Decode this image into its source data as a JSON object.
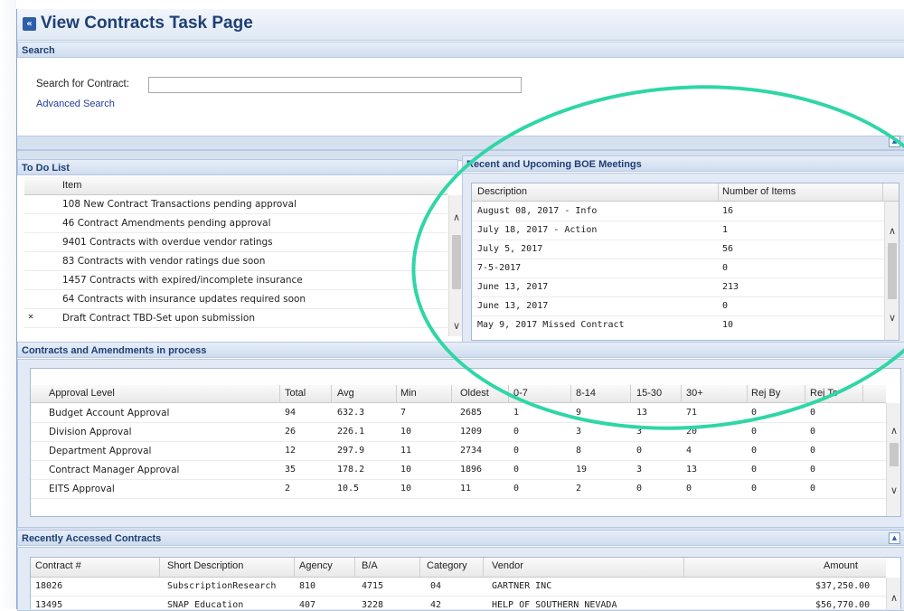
{
  "page": {
    "title": "View Contracts Task Page",
    "collapse_icon": "double-chevron-left-icon"
  },
  "search": {
    "header": "Search",
    "label": "Search for Contract:",
    "value": "",
    "placeholder": "",
    "advanced_link": "Advanced Search"
  },
  "todo": {
    "header": "To Do List",
    "column": "Item",
    "items": [
      {
        "icon": "",
        "text": "108 New Contract Transactions pending approval"
      },
      {
        "icon": "",
        "text": "46 Contract Amendments pending approval"
      },
      {
        "icon": "",
        "text": "9401 Contracts with overdue vendor ratings"
      },
      {
        "icon": "",
        "text": "83 Contracts with vendor ratings due soon"
      },
      {
        "icon": "",
        "text": "1457 Contracts with expired/incomplete insurance"
      },
      {
        "icon": "",
        "text": "64 Contracts with insurance updates required soon"
      },
      {
        "icon": "✕",
        "text": "Draft Contract TBD-Set upon submission"
      }
    ]
  },
  "boe": {
    "header": "Recent and Upcoming BOE Meetings",
    "columns": [
      "Description",
      "Number of Items"
    ],
    "rows": [
      [
        "August 08, 2017 - Info",
        "16"
      ],
      [
        "July 18, 2017 - Action",
        "1"
      ],
      [
        "July 5, 2017",
        "56"
      ],
      [
        "7-5-2017",
        "0"
      ],
      [
        "June 13, 2017",
        "213"
      ],
      [
        "June 13, 2017",
        "0"
      ],
      [
        "May 9, 2017 Missed Contract",
        "10"
      ]
    ]
  },
  "process": {
    "header": "Contracts and Amendments in process",
    "columns": [
      "Approval Level",
      "Total",
      "Avg",
      "Min",
      "Oldest",
      "0-7",
      "8-14",
      "15-30",
      "30+",
      "Rej By",
      "Rej To"
    ],
    "rows": [
      [
        "Budget Account Approval",
        "94",
        "632.3",
        "7",
        "2685",
        "1",
        "9",
        "13",
        "71",
        "0",
        "0"
      ],
      [
        "Division Approval",
        "26",
        "226.1",
        "10",
        "1209",
        "0",
        "3",
        "3",
        "20",
        "0",
        "0"
      ],
      [
        "Department Approval",
        "12",
        "297.9",
        "11",
        "2734",
        "0",
        "8",
        "0",
        "4",
        "0",
        "0"
      ],
      [
        "Contract Manager Approval",
        "35",
        "178.2",
        "10",
        "1896",
        "0",
        "19",
        "3",
        "13",
        "0",
        "0"
      ],
      [
        "EITS Approval",
        "2",
        "10.5",
        "10",
        "11",
        "0",
        "2",
        "0",
        "0",
        "0",
        "0"
      ]
    ]
  },
  "recent": {
    "header": "Recently Accessed Contracts",
    "columns": [
      "Contract #",
      "Short Description",
      "Agency",
      "B/A",
      "Category",
      "Vendor",
      "Amount"
    ],
    "rows": [
      [
        "18026",
        "SubscriptionResearch",
        "810",
        "4715",
        "04",
        "GARTNER INC",
        "$37,250.00"
      ],
      [
        "13495",
        "SNAP Education",
        "407",
        "3228",
        "42",
        "HELP OF SOUTHERN NEVADA",
        "$56,770.00"
      ]
    ]
  },
  "colors": {
    "accent": "#1f3f73",
    "annotation": "#2fd6a6",
    "reject_icon": "#d23a2a"
  }
}
